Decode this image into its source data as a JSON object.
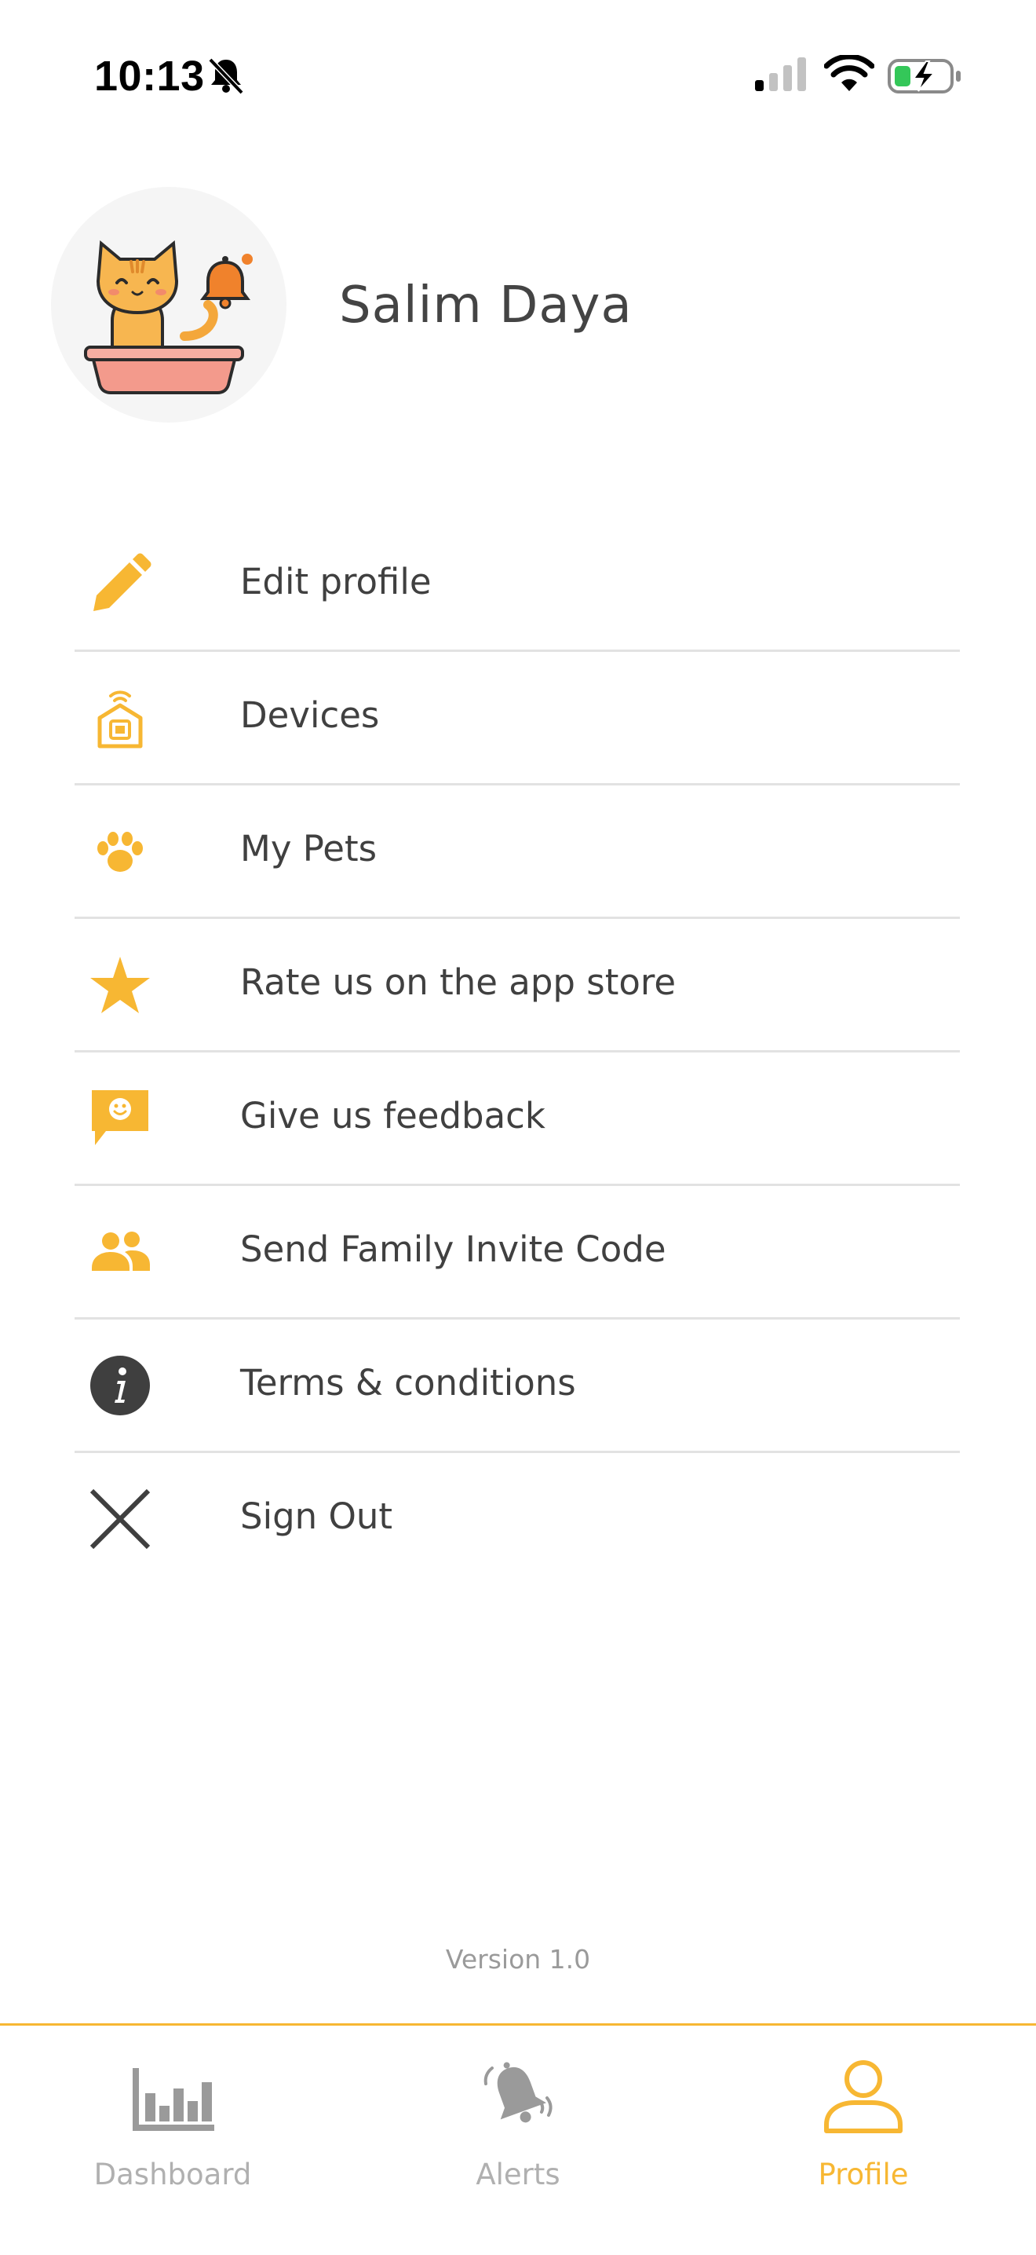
{
  "status_bar": {
    "time": "10:13",
    "mute_icon": "bell-slash-icon",
    "signal_icon": "cellular-signal-icon",
    "wifi_icon": "wifi-icon",
    "battery_icon": "battery-charging-icon"
  },
  "profile": {
    "name": "Salim Daya",
    "avatar_icon": "cat-litter-box-bell-icon"
  },
  "menu": {
    "items": [
      {
        "label": "Edit profile",
        "icon": "pencil-icon"
      },
      {
        "label": "Devices",
        "icon": "device-icon"
      },
      {
        "label": "My Pets",
        "icon": "paw-icon"
      },
      {
        "label": "Rate us on the app store",
        "icon": "star-icon"
      },
      {
        "label": "Give us feedback",
        "icon": "feedback-chat-icon"
      },
      {
        "label": "Send Family Invite Code",
        "icon": "family-icon"
      },
      {
        "label": "Terms & conditions",
        "icon": "info-icon"
      },
      {
        "label": "Sign Out",
        "icon": "close-icon"
      }
    ]
  },
  "version_text": "Version 1.0",
  "tab_bar": {
    "tabs": [
      {
        "label": "Dashboard",
        "icon": "bar-chart-icon",
        "active": false
      },
      {
        "label": "Alerts",
        "icon": "bell-ringing-icon",
        "active": false
      },
      {
        "label": "Profile",
        "icon": "person-icon",
        "active": true
      }
    ]
  },
  "colors": {
    "accent": "#f7b733",
    "text": "#404040",
    "divider": "#e2e2e2",
    "inactive_tab": "#b0b0b0"
  }
}
